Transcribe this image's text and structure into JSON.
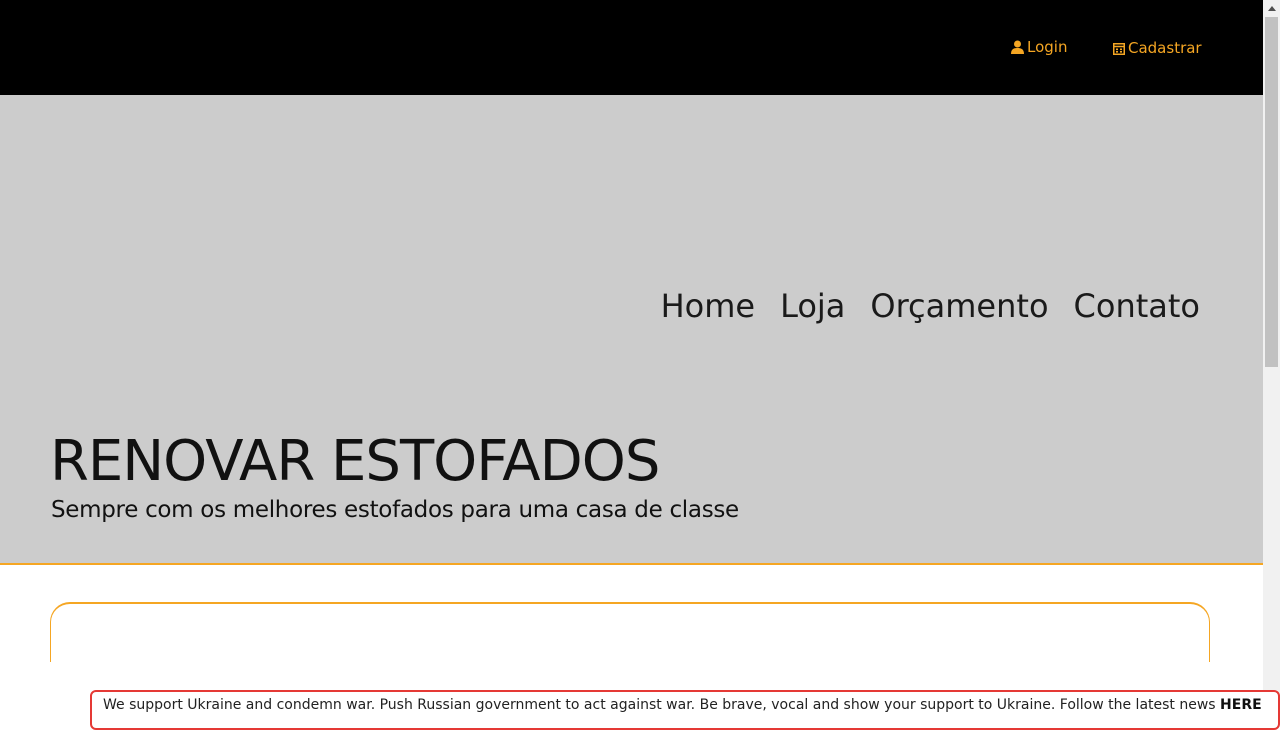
{
  "header": {
    "login_label": "Login",
    "signup_label": "Cadastrar",
    "accent_color": "#f5a623"
  },
  "nav": {
    "items": [
      "Home",
      "Loja",
      "Orçamento",
      "Contato"
    ]
  },
  "hero": {
    "title": "RENOVAR ESTOFADOS",
    "subtitle": "Sempre com os melhores estofados para uma casa de classe",
    "background_color": "#cccccc"
  },
  "banner": {
    "text": "We support Ukraine and condemn war. Push Russian government to act against war. Be brave, vocal and show your support to Ukraine. Follow the latest news",
    "link_label": "HERE",
    "border_color": "#e53935"
  },
  "icons": {
    "login": "user-icon",
    "signup": "calendar-icon"
  }
}
